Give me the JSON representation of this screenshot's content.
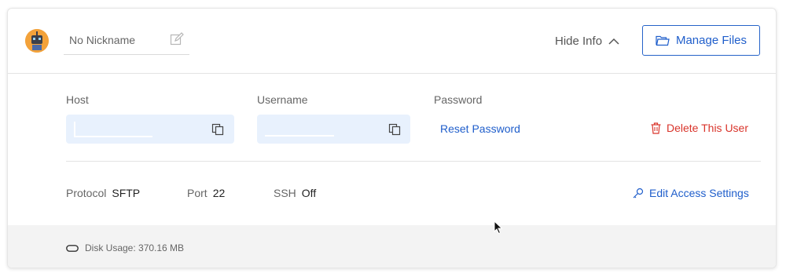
{
  "header": {
    "nickname": "No Nickname",
    "hide_info": "Hide Info",
    "manage_files": "Manage Files"
  },
  "credentials": {
    "host_label": "Host",
    "username_label": "Username",
    "password_label": "Password",
    "reset_password": "Reset Password",
    "delete_user": "Delete This User"
  },
  "connection": {
    "protocol_label": "Protocol",
    "protocol_value": "SFTP",
    "port_label": "Port",
    "port_value": "22",
    "ssh_label": "SSH",
    "ssh_value": "Off",
    "edit_access": "Edit Access Settings"
  },
  "footer": {
    "disk_usage": "Disk Usage: 370.16 MB"
  },
  "colors": {
    "accent": "#1f5ecb",
    "danger": "#d9342b",
    "field_bg": "#e8f1fd",
    "avatar": "#f3a23a"
  },
  "icons": [
    "robot-avatar",
    "edit-icon",
    "chevron-up-icon",
    "folder-icon",
    "copy-icon",
    "trash-icon",
    "key-icon",
    "disk-icon",
    "mouse-cursor"
  ]
}
